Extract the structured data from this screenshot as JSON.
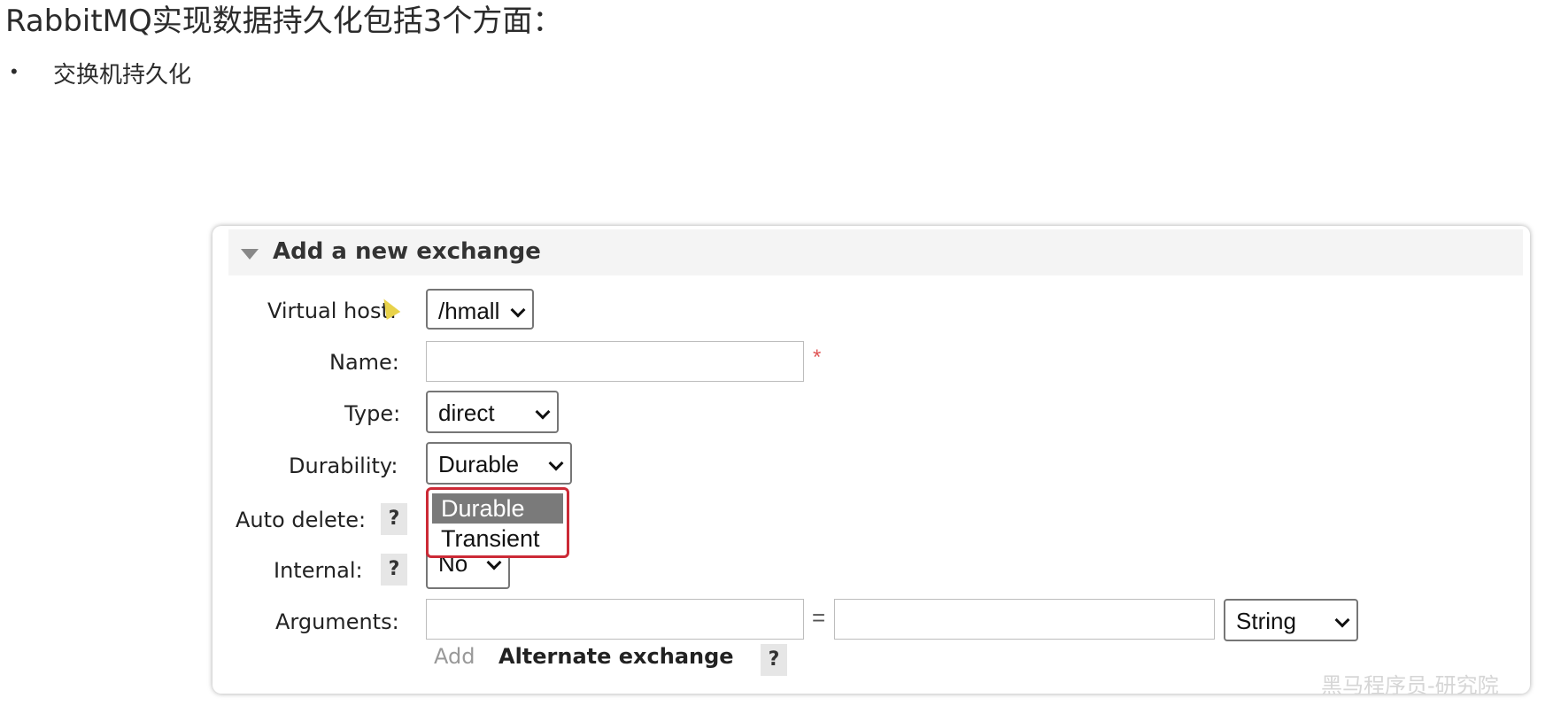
{
  "heading": "RabbitMQ实现数据持久化包括3个方面：",
  "bullet": {
    "symbol": "•",
    "text": "交换机持久化"
  },
  "form": {
    "title": "Add a new exchange",
    "virtual_host": {
      "label": "Virtual host:",
      "value": "/hmall"
    },
    "name": {
      "label": "Name:",
      "value": "",
      "required_mark": "*"
    },
    "type": {
      "label": "Type:",
      "value": "direct"
    },
    "durability": {
      "label": "Durability:",
      "value": "Durable",
      "options": [
        "Durable",
        "Transient"
      ],
      "highlighted": "Durable"
    },
    "auto_delete": {
      "label": "Auto delete:",
      "help": "?"
    },
    "internal": {
      "label": "Internal:",
      "help": "?",
      "value": "No"
    },
    "arguments": {
      "label": "Arguments:",
      "equals": "=",
      "type_value": "String"
    },
    "add_label": "Add",
    "alternate_exchange": {
      "label": "Alternate exchange",
      "help": "?"
    }
  },
  "watermark": "黑马程序员-研究院",
  "colors": {
    "dropdown_border": "#cc2a36",
    "selected_option": "#7a7a7a",
    "header_bg": "#f4f4f4",
    "required": "#e05555"
  }
}
